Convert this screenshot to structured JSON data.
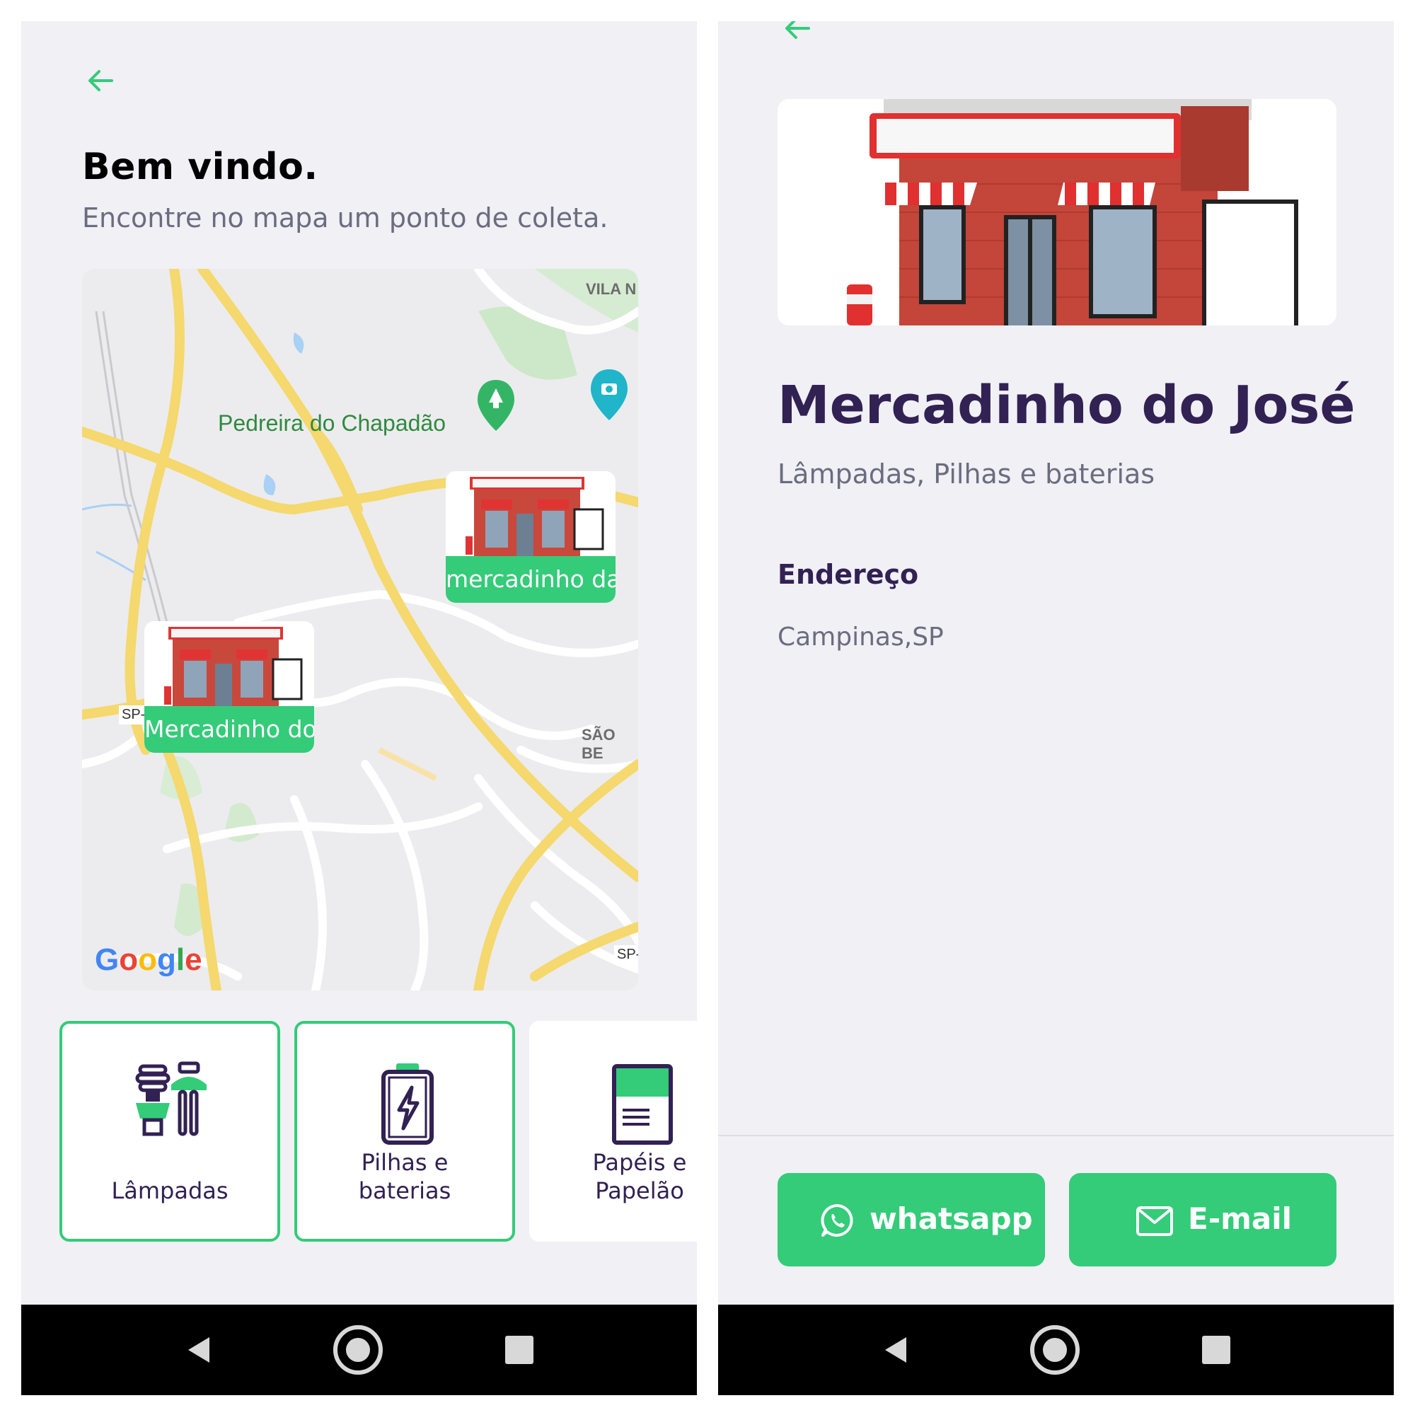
{
  "left_screen": {
    "welcome": {
      "title": "Bem vindo.",
      "subtitle": "Encontre no mapa um ponto de coleta."
    },
    "map": {
      "labels": {
        "park": "Pedreira do Chapadão",
        "vila": "VILA N",
        "sao_bento": "SÃO BE",
        "road_sp_left": "SP-",
        "road_sp_right": "SP-",
        "google": "Google"
      },
      "markers": [
        {
          "label": "mercadinho da"
        },
        {
          "label": "Mercadinho do"
        }
      ]
    },
    "items": [
      {
        "label_line1": "Lâmpadas",
        "label_line2": "",
        "icon": "lamp-icon",
        "selected": true
      },
      {
        "label_line1": "Pilhas e",
        "label_line2": "baterias",
        "icon": "battery-icon",
        "selected": true
      },
      {
        "label_line1": "Papéis e",
        "label_line2": "Papelão",
        "icon": "paper-icon",
        "selected": false
      }
    ]
  },
  "right_screen": {
    "point": {
      "name": "Mercadinho do José",
      "items": "Lâmpadas, Pilhas e baterias"
    },
    "address": {
      "title": "Endereço",
      "value": "Campinas,SP"
    },
    "buttons": {
      "whatsapp_label": "whatsapp",
      "email_label": "E-mail"
    }
  },
  "colors": {
    "accent_green": "#34cb79",
    "title_purple": "#322153",
    "text_gray": "#6c6c80",
    "background": "#f0f0f5"
  }
}
